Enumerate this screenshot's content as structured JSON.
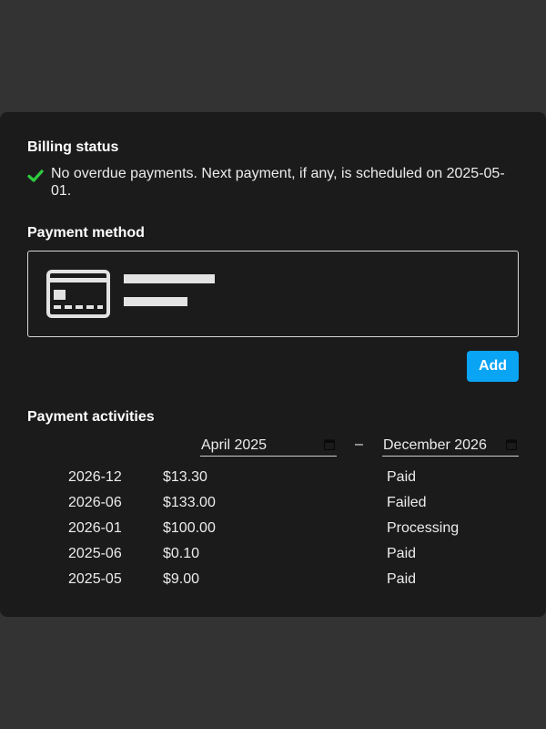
{
  "billing": {
    "title": "Billing status",
    "status_text": "No overdue payments. Next payment, if any, is scheduled on 2025-05-01."
  },
  "payment_method": {
    "title": "Payment method",
    "add_label": "Add"
  },
  "activities": {
    "title": "Payment activities",
    "from_date": "April 2025",
    "to_date": "December 2026",
    "separator": "–",
    "rows": [
      {
        "date": "2026-12",
        "amount": "$13.30",
        "status": "Paid"
      },
      {
        "date": "2026-06",
        "amount": "$133.00",
        "status": "Failed"
      },
      {
        "date": "2026-01",
        "amount": "$100.00",
        "status": "Processing"
      },
      {
        "date": "2025-06",
        "amount": "$0.10",
        "status": "Paid"
      },
      {
        "date": "2025-05",
        "amount": "$9.00",
        "status": "Paid"
      }
    ]
  },
  "colors": {
    "background": "#333333",
    "panel": "#1b1b1b",
    "accent": "#0aa4f5",
    "success": "#2ecc40"
  },
  "icons": [
    "checkmark-icon",
    "credit-card-icon",
    "calendar-icon"
  ]
}
